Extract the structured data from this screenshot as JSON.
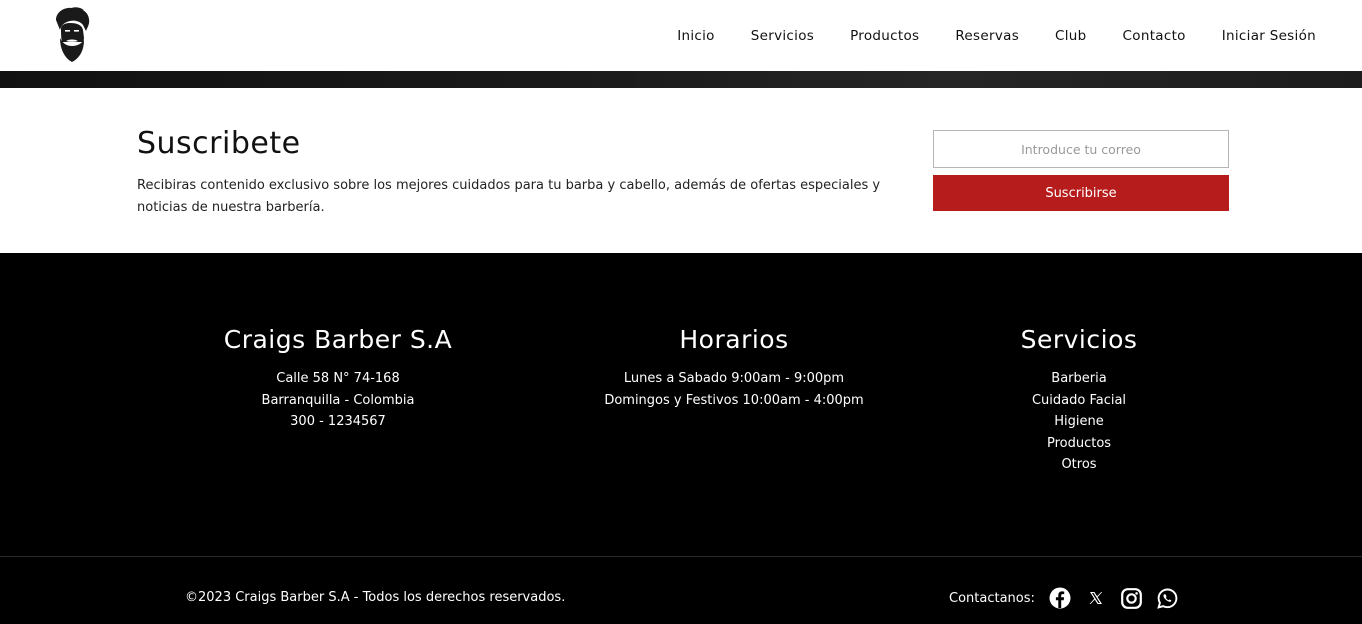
{
  "header": {
    "nav": [
      "Inicio",
      "Servicios",
      "Productos",
      "Reservas",
      "Club",
      "Contacto",
      "Iniciar Sesión"
    ]
  },
  "subscribe": {
    "title": "Suscribete",
    "text": "Recibiras contenido exclusivo sobre los mejores cuidados para tu barba y cabello, además de ofertas especiales y noticias de nuestra barbería.",
    "placeholder": "Introduce tu correo",
    "button": "Suscribirse"
  },
  "footer": {
    "company": {
      "title": "Craigs Barber S.A",
      "lines": [
        "Calle 58 N° 74-168",
        "Barranquilla - Colombia",
        "300 - 1234567"
      ]
    },
    "hours": {
      "title": "Horarios",
      "lines": [
        "Lunes a Sabado 9:00am - 9:00pm",
        "Domingos y Festivos 10:00am - 4:00pm"
      ]
    },
    "services": {
      "title": "Servicios",
      "items": [
        "Barberia",
        "Cuidado Facial",
        "Higiene",
        "Productos",
        "Otros"
      ]
    },
    "copyright": "©2023 Craigs Barber S.A - Todos los derechos reservados.",
    "contact_label": "Contactanos:",
    "social_icons": [
      "facebook-icon",
      "x-icon",
      "instagram-icon",
      "whatsapp-icon"
    ]
  },
  "colors": {
    "accent": "#b71c1c",
    "footer_bg": "#000000"
  }
}
